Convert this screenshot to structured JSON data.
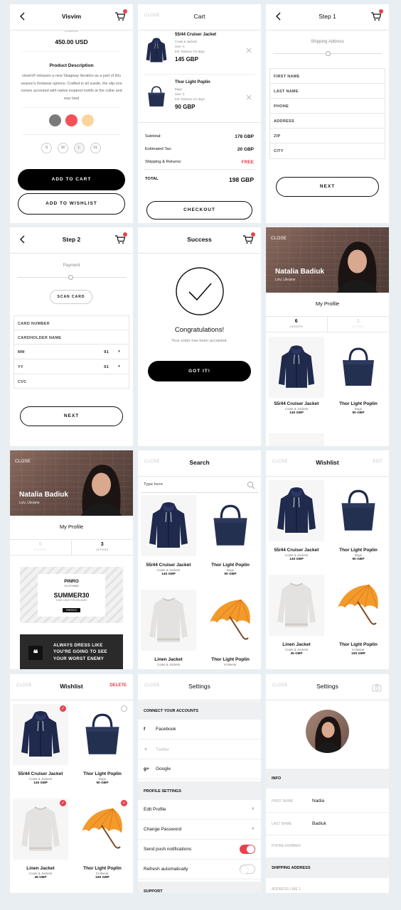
{
  "product": {
    "title": "Visvim",
    "category": "Knitwear",
    "price": "450.00 USD",
    "desc_title": "Product Description",
    "description": "visvim® releases a new Skagway iteration as a part of this season's footwear options. Crafted in all suede, the slip-ons comes accented with native inspired motifs at the collar and rear heel",
    "colors": [
      "#7a7a7a",
      "#f25257",
      "#fbd49e"
    ],
    "sizes": [
      "S",
      "M",
      "L",
      "XL"
    ],
    "add_to_cart": "ADD TO CART",
    "add_to_wishlist": "ADD TO WISHLIST"
  },
  "cart": {
    "close": "CLOSE",
    "title": "Cart",
    "items": [
      {
        "name": "55/44 Cruiser Jacket",
        "sub": "Coats & Jackets",
        "size": "Size: S",
        "delivery": "Est. Delivery 3-6 days",
        "price": "145 GBP"
      },
      {
        "name": "Thor Light Poplin",
        "sub": "Bags",
        "size": "Size: S",
        "delivery": "Est. Delivery 3-6 days",
        "price": "90 GBP"
      }
    ],
    "subtotal_label": "Subtotal:",
    "subtotal": "178 GBP",
    "tax_label": "Estimated Tax:",
    "tax": "20 GBP",
    "ship_label": "Shipping & Returns:",
    "ship": "FREE",
    "total_label": "TOTAL",
    "total": "198 GBP",
    "checkout": "CHECKOUT"
  },
  "step1": {
    "title": "Step 1",
    "section": "Shipping Address",
    "fields": [
      "FIRST NAME",
      "LAST NAME",
      "PHONE",
      "ADDRESS",
      "ZIP",
      "CITY"
    ],
    "next": "NEXT"
  },
  "step2": {
    "title": "Step 2",
    "section": "Payment",
    "scan": "SCAN CARD",
    "card_number": "CARD NUMBER",
    "cardholder": "CARDHOLDER NAME",
    "mm": "MM",
    "mm_val": "01",
    "yy": "YY",
    "yy_val": "01",
    "cvc": "CVC",
    "next": "NEXT"
  },
  "success": {
    "title": "Success",
    "heading": "Congratulations!",
    "message": "Your order has been accepted.",
    "button": "GOT IT!"
  },
  "profile": {
    "close": "CLOSE",
    "name": "Natalia Badiuk",
    "location": "Lviv, Ukraine",
    "section": "My Profile",
    "orders_count": "6",
    "orders_label": "ORDERS",
    "offers_count": "3",
    "offers_label": "OFFERS",
    "products": [
      {
        "name": "55/44 Cruiser Jacket",
        "sub": "Coats & Jackets",
        "price": "145 GBP"
      },
      {
        "name": "Thor Light Poplin",
        "sub": "Bags",
        "price": "90 GBP"
      }
    ]
  },
  "offers": {
    "coupon_brand": "PINRO",
    "coupon_type": "CLOTHING",
    "coupon_code": "SUMMER30",
    "coupon_sub": "YOUR CODE FOR DISCOUNT",
    "coupon_tag": "PINROCO",
    "quote": "ALWAYS DRESS LIKE YOU'RE GOING TO SEE YOUR WORST ENEMY"
  },
  "search": {
    "close": "CLOSE",
    "title": "Search",
    "placeholder": "Type here",
    "products": [
      {
        "name": "55/44 Cruiser Jacket",
        "sub": "Coats & Jackets",
        "price": "145 GBP"
      },
      {
        "name": "Thor Light Poplin",
        "sub": "Bags",
        "price": "90 GBP"
      },
      {
        "name": "Linen Jacket",
        "sub": "Coats & Jackets",
        "price": "45 GBP"
      },
      {
        "name": "Thor Light Poplin",
        "sub": "Knitwear",
        "price": "155 GBP"
      }
    ]
  },
  "wishlist": {
    "close": "CLOSE",
    "title": "Wishlist",
    "edit": "EDIT",
    "delete": "DELETE",
    "products": [
      {
        "name": "55/44 Cruiser Jacket",
        "sub": "Coats & Jackets",
        "price": "145 GBP"
      },
      {
        "name": "Thor Light Poplin",
        "sub": "Bags",
        "price": "90 GBP"
      },
      {
        "name": "Linen Jacket",
        "sub": "Coats & Jackets",
        "price": "45 GBP"
      },
      {
        "name": "Thor Light Poplin",
        "sub": "Knitwear",
        "price": "155 GBP"
      }
    ]
  },
  "settings": {
    "close": "CLOSE",
    "title": "Settings",
    "connect": "CONNECT YOUR ACCOUNTS",
    "facebook": "Facebook",
    "twitter": "Twitter",
    "google": "Google",
    "profile_settings": "PROFILE SETTINGS",
    "edit_profile": "Edit Profile",
    "change_password": "Change Password",
    "push": "Send push notifications",
    "refresh": "Refresh automatically",
    "support": "SUPPORT"
  },
  "settings2": {
    "close": "CLOSE",
    "title": "Settings",
    "info": "INFO",
    "first_label": "FIRST NAME",
    "first": "Nadia",
    "last_label": "LAST NAME",
    "last": "Badiuk",
    "phone_label": "PHONE NUMBER",
    "shipping": "SHIPPING ADDRESS",
    "address_label": "ADDRESS LINE 1"
  }
}
